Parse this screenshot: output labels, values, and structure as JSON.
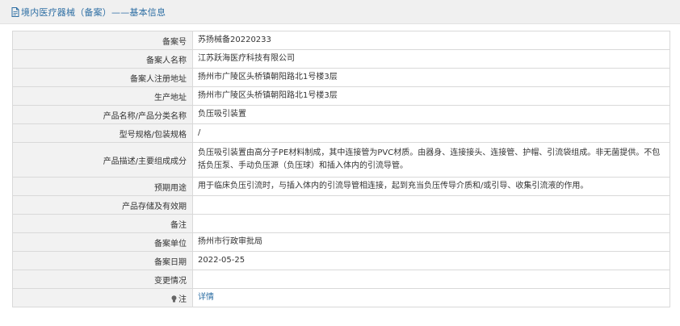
{
  "page": {
    "title": "境内医疗器械（备案）——基本信息",
    "title_icon": "document-icon",
    "accent_color": "#2d6ea3"
  },
  "rows": [
    {
      "label": "备案号",
      "value": "苏扬械备20220233"
    },
    {
      "label": "备案人名称",
      "value": "江苏跃海医疗科技有限公司"
    },
    {
      "label": "备案人注册地址",
      "value": "扬州市广陵区头桥镇朝阳路北1号楼3层"
    },
    {
      "label": "生产地址",
      "value": "扬州市广陵区头桥镇朝阳路北1号楼3层"
    },
    {
      "label": "产品名称/产品分类名称",
      "value": "负压吸引装置"
    },
    {
      "label": "型号规格/包装规格",
      "value": "/"
    },
    {
      "label": "产品描述/主要组成成分",
      "value": "负压吸引装置由高分子PE材料制成，其中连接管为PVC材质。由器身、连接接头、连接管、护帽、引流袋组成。非无菌提供。不包括负压泵、手动负压源（负压球）和插入体内的引流导管。"
    },
    {
      "label": "预期用途",
      "value": "用于临床负压引流时，与插入体内的引流导管相连接，起到充当负压传导介质和/或引导、收集引流液的作用。"
    },
    {
      "label": "产品存储及有效期",
      "value": ""
    },
    {
      "label": "备注",
      "value": ""
    },
    {
      "label": "备案单位",
      "value": "扬州市行政审批局"
    },
    {
      "label": "备案日期",
      "value": "2022-05-25"
    },
    {
      "label": "变更情况",
      "value": ""
    },
    {
      "label": "注",
      "value": "详情",
      "icon": "bulb-icon"
    }
  ]
}
